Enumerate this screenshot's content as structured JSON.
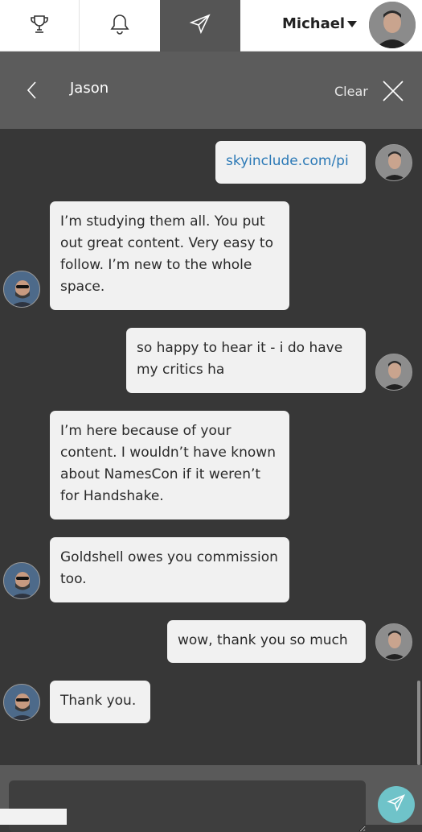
{
  "nav": {
    "icons": [
      "trophy-icon",
      "bell-icon",
      "paper-plane-icon"
    ],
    "active_index": 2
  },
  "user": {
    "name": "Michael"
  },
  "chat": {
    "contact": "Jason",
    "clear_label": "Clear"
  },
  "messages": [
    {
      "from": "me",
      "text": "skyinclude.com/pi",
      "is_link": true
    },
    {
      "from": "them",
      "text": "I’m studying them all. You put out great content. Very easy to follow. I’m new to the whole space."
    },
    {
      "from": "me",
      "text": "so happy to hear it - i do have my critics ha"
    },
    {
      "from": "them",
      "text": "I’m here because of your content. I wouldn’t have known about NamesCon if it weren’t for Handshake."
    },
    {
      "from": "them",
      "text": "Goldshell owes you commission too."
    },
    {
      "from": "me",
      "text": "wow, thank you so much"
    },
    {
      "from": "them",
      "text": "Thank you."
    }
  ],
  "composer": {
    "placeholder": ""
  },
  "colors": {
    "accent": "#6fc3c9",
    "link": "#2b79b6",
    "header": "#5c5c5c",
    "background": "#373737"
  }
}
